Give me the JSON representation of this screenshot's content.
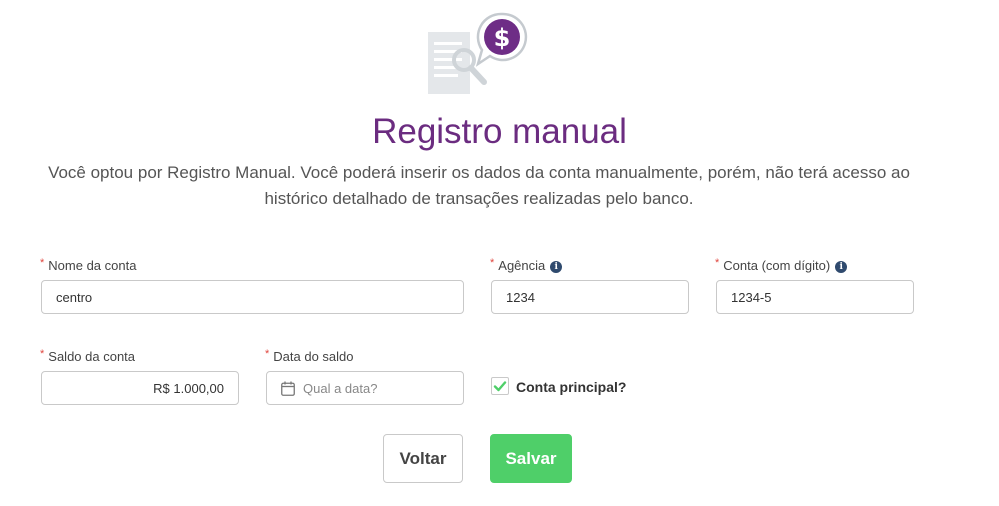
{
  "header": {
    "icon": "document-dollar-search-icon",
    "title": "Registro manual",
    "description": "Você optou por Registro Manual. Você poderá inserir os dados da conta manualmente, porém, não terá acesso ao histórico detalhado de transações realizadas pelo banco."
  },
  "form": {
    "required_mark": "*",
    "info_glyph": "i",
    "account_name": {
      "label": "Nome da conta",
      "value": "centro"
    },
    "agency": {
      "label": "Agência",
      "value": "1234"
    },
    "account_number": {
      "label": "Conta (com dígito)",
      "value": "1234-5"
    },
    "balance": {
      "label": "Saldo da conta",
      "value": "R$ 1.000,00"
    },
    "balance_date": {
      "label": "Data do saldo",
      "placeholder": "Qual a data?"
    },
    "main_account": {
      "label": "Conta principal?",
      "checked": true
    }
  },
  "actions": {
    "back_label": "Voltar",
    "save_label": "Salvar"
  },
  "colors": {
    "title": "#6b2c80",
    "required": "#e0443c",
    "save_button": "#4fcf69",
    "check": "#4fcf69",
    "info_icon": "#2f4a6e"
  }
}
